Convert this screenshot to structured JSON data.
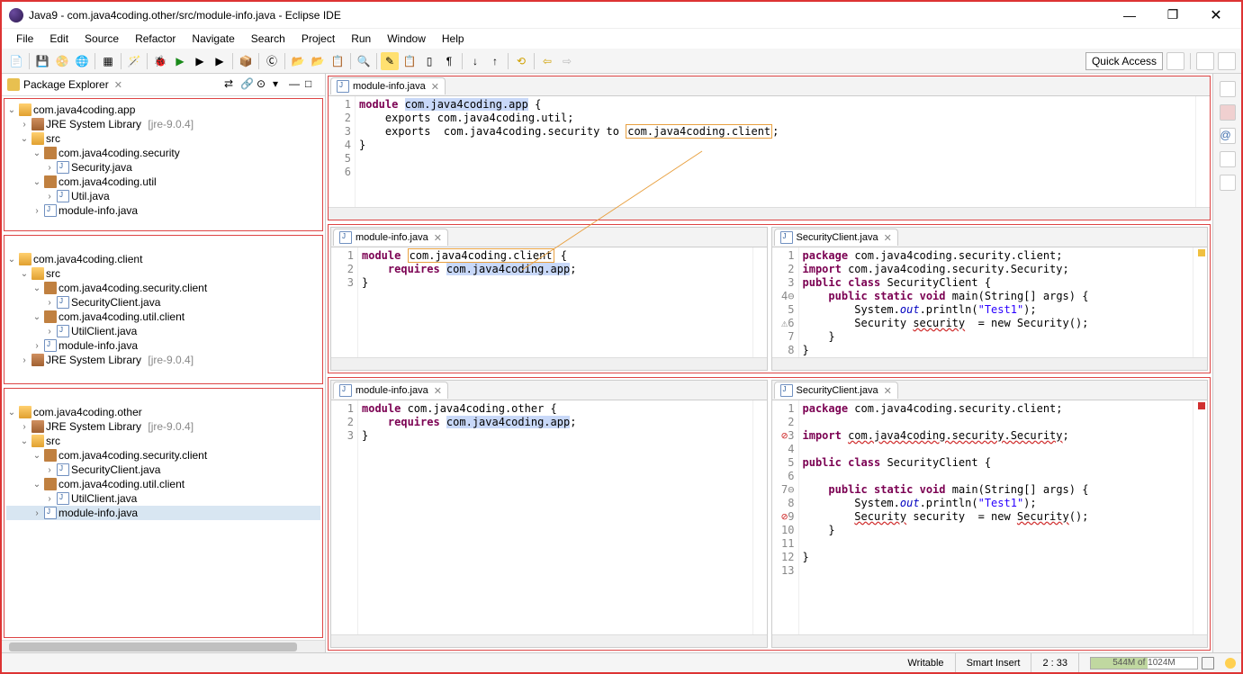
{
  "window": {
    "title": "Java9 - com.java4coding.other/src/module-info.java - Eclipse IDE"
  },
  "menus": [
    "File",
    "Edit",
    "Source",
    "Refactor",
    "Navigate",
    "Search",
    "Project",
    "Run",
    "Window",
    "Help"
  ],
  "quick_access": "Quick Access",
  "package_explorer": {
    "title": "Package Explorer",
    "jre_label": "JRE System Library",
    "jre_ver": "[jre-9.0.4]",
    "src": "src",
    "projects": [
      {
        "name": "com.java4coding.app",
        "packages": [
          {
            "name": "com.java4coding.security",
            "files": [
              "Security.java"
            ]
          },
          {
            "name": "com.java4coding.util",
            "files": [
              "Util.java"
            ]
          }
        ],
        "module_info": "module-info.java"
      },
      {
        "name": "com.java4coding.client",
        "packages": [
          {
            "name": "com.java4coding.security.client",
            "files": [
              "SecurityClient.java"
            ]
          },
          {
            "name": "com.java4coding.util.client",
            "files": [
              "UtilClient.java"
            ]
          }
        ],
        "module_info": "module-info.java"
      },
      {
        "name": "com.java4coding.other",
        "packages": [
          {
            "name": "com.java4coding.security.client",
            "files": [
              "SecurityClient.java"
            ]
          },
          {
            "name": "com.java4coding.util.client",
            "files": [
              "UtilClient.java"
            ]
          }
        ],
        "module_info": "module-info.java"
      }
    ]
  },
  "editors": {
    "tab_module": "module-info.java",
    "tab_secclient": "SecurityClient.java",
    "app_module": {
      "l1a": "module ",
      "l1b": "com.java4coding.app",
      "l1c": " {",
      "l2": "    exports com.java4coding.util;",
      "l3a": "    exports  com.java4coding.security to ",
      "l3b": "com.java4coding.client",
      "l3c": ";",
      "l4": "}"
    },
    "client_module": {
      "l1a": "module ",
      "l1b": "com.java4coding.client",
      "l1c": " {",
      "l2a": "    requires ",
      "l2b": "com.java4coding.app",
      "l2c": ";",
      "l3": "}"
    },
    "other_module": {
      "l1": "module com.java4coding.other {",
      "l2a": "    requires ",
      "l2b": "com.java4coding.app",
      "l2c": ";",
      "l3": "}"
    },
    "secclient1": {
      "l1": "package com.java4coding.security.client;",
      "l2": "import com.java4coding.security.Security;",
      "l3": "public class SecurityClient {",
      "l4": "    public static void main(String[] args) {",
      "l5a": "        System.",
      "l5b": "out",
      "l5c": ".println(",
      "l5d": "\"Test1\"",
      "l5e": ");",
      "l6a": "        Security ",
      "l6b": "security",
      "l6c": "  = new Security();",
      "l7": "    }",
      "l8": "}"
    },
    "secclient2": {
      "l1": "package com.java4coding.security.client;",
      "l2": "",
      "l3a": "import ",
      "l3b": "com.java4coding.security.Security",
      "l3c": ";",
      "l4": "",
      "l5": "public class SecurityClient {",
      "l6": "",
      "l7": "    public static void main(String[] args) {",
      "l8a": "        System.",
      "l8b": "out",
      "l8c": ".println(",
      "l8d": "\"Test1\"",
      "l8e": ");",
      "l9a": "        ",
      "l9b": "Security",
      "l9c": " security  = new ",
      "l9d": "Security",
      "l9e": "();",
      "l10": "    }",
      "l11": "",
      "l12": "}",
      "l13": ""
    }
  },
  "status": {
    "writable": "Writable",
    "insert": "Smart Insert",
    "pos": "2 : 33",
    "mem": "544M of 1024M"
  }
}
